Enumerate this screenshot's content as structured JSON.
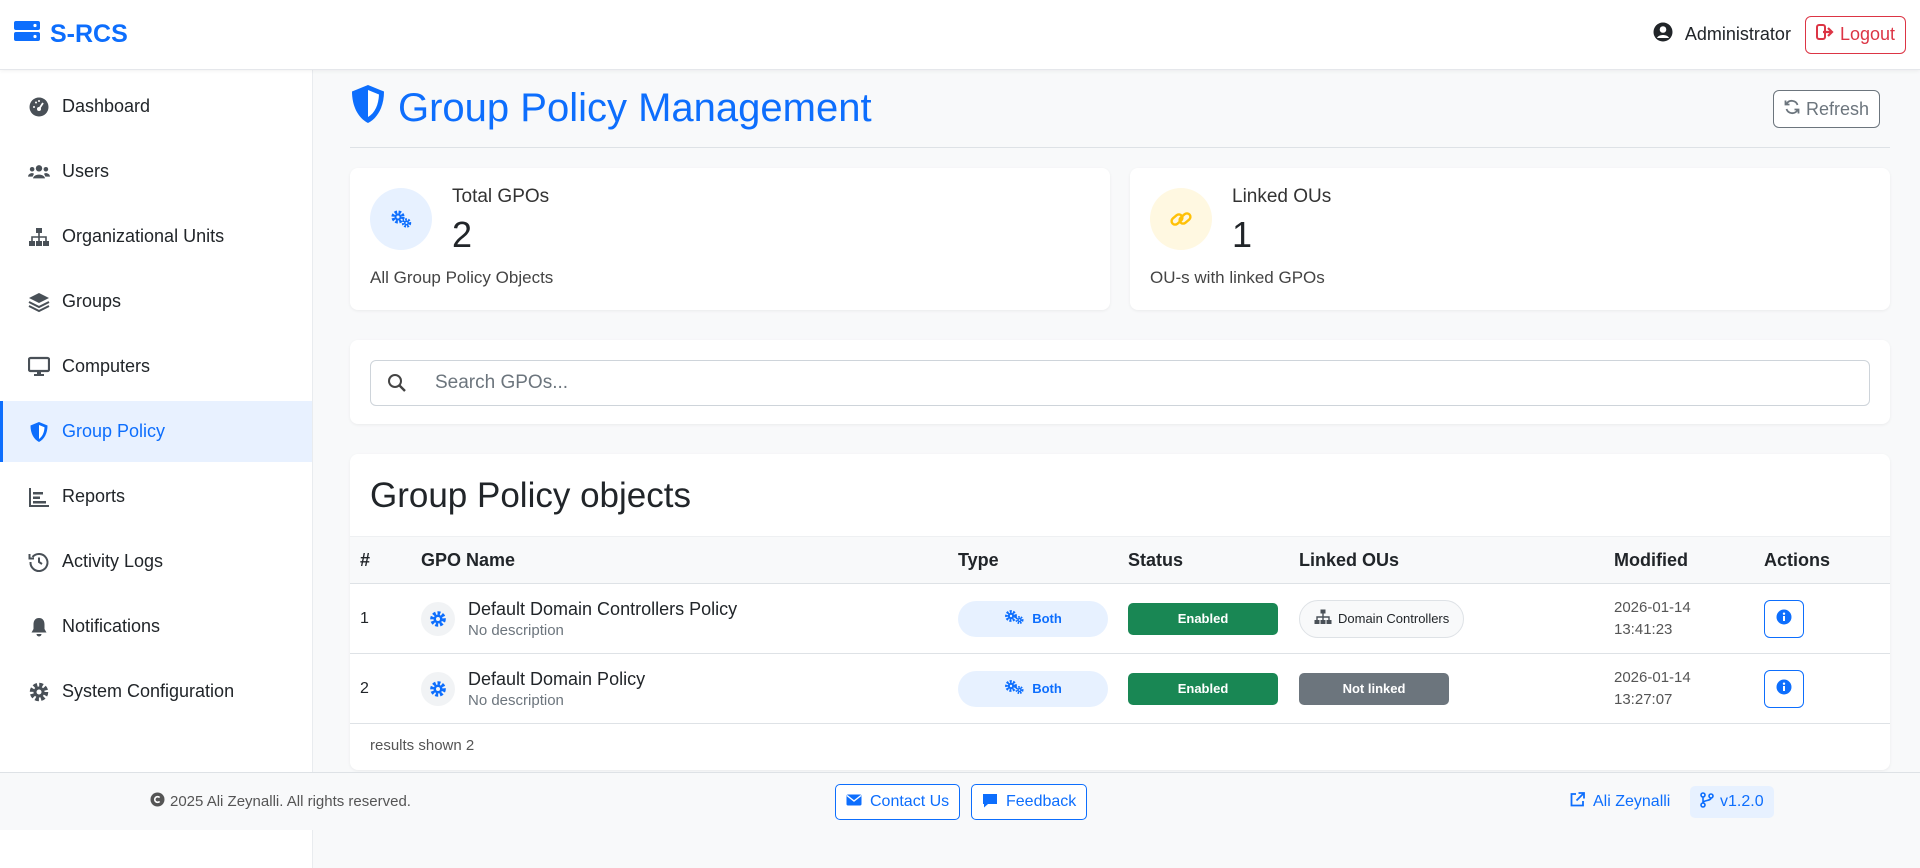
{
  "app": {
    "brand": "S-RCS",
    "user": "Administrator",
    "logout_label": "Logout"
  },
  "sidebar": {
    "items": [
      {
        "label": "Dashboard",
        "icon": "dashboard-gauge-icon"
      },
      {
        "label": "Users",
        "icon": "users-icon"
      },
      {
        "label": "Organizational Units",
        "icon": "sitemap-icon"
      },
      {
        "label": "Groups",
        "icon": "layers-icon"
      },
      {
        "label": "Computers",
        "icon": "desktop-icon"
      },
      {
        "label": "Group Policy",
        "icon": "shield-icon",
        "active": true
      },
      {
        "label": "Reports",
        "icon": "chart-icon"
      },
      {
        "label": "Activity Logs",
        "icon": "history-icon"
      },
      {
        "label": "Notifications",
        "icon": "bell-icon"
      },
      {
        "label": "System Configuration",
        "icon": "gear-icon"
      }
    ]
  },
  "header": {
    "title": "Group Policy Management",
    "refresh_label": "Refresh"
  },
  "stats": {
    "total": {
      "label": "Total GPOs",
      "value": "2",
      "desc": "All Group Policy Objects"
    },
    "linked": {
      "label": "Linked OUs",
      "value": "1",
      "desc": "OU-s with linked GPOs"
    }
  },
  "search": {
    "placeholder": "Search GPOs..."
  },
  "table": {
    "title": "Group Policy objects",
    "columns": [
      "#",
      "GPO Name",
      "Type",
      "Status",
      "Linked OUs",
      "Modified",
      "Actions"
    ],
    "rows": [
      {
        "num": "1",
        "name": "Default Domain Controllers Policy",
        "desc": "No description",
        "type": "Both",
        "status": "Enabled",
        "linked": "Domain Controllers",
        "modified_date": "2026-01-14",
        "modified_time": "13:41:23"
      },
      {
        "num": "2",
        "name": "Default Domain Policy",
        "desc": "No description",
        "type": "Both",
        "status": "Enabled",
        "linked": "Not linked",
        "modified_date": "2026-01-14",
        "modified_time": "13:27:07"
      }
    ],
    "footer": "results shown 2"
  },
  "footer": {
    "copyright": "2025 Ali Zeynalli. All rights reserved.",
    "contact_label": "Contact Us",
    "feedback_label": "Feedback",
    "author": "Ali Zeynalli",
    "version": "v1.2.0"
  },
  "colors": {
    "primary": "#0d6efd",
    "success": "#198754",
    "danger": "#dc3545",
    "secondary": "#6c757d",
    "warning": "#ffc107"
  }
}
